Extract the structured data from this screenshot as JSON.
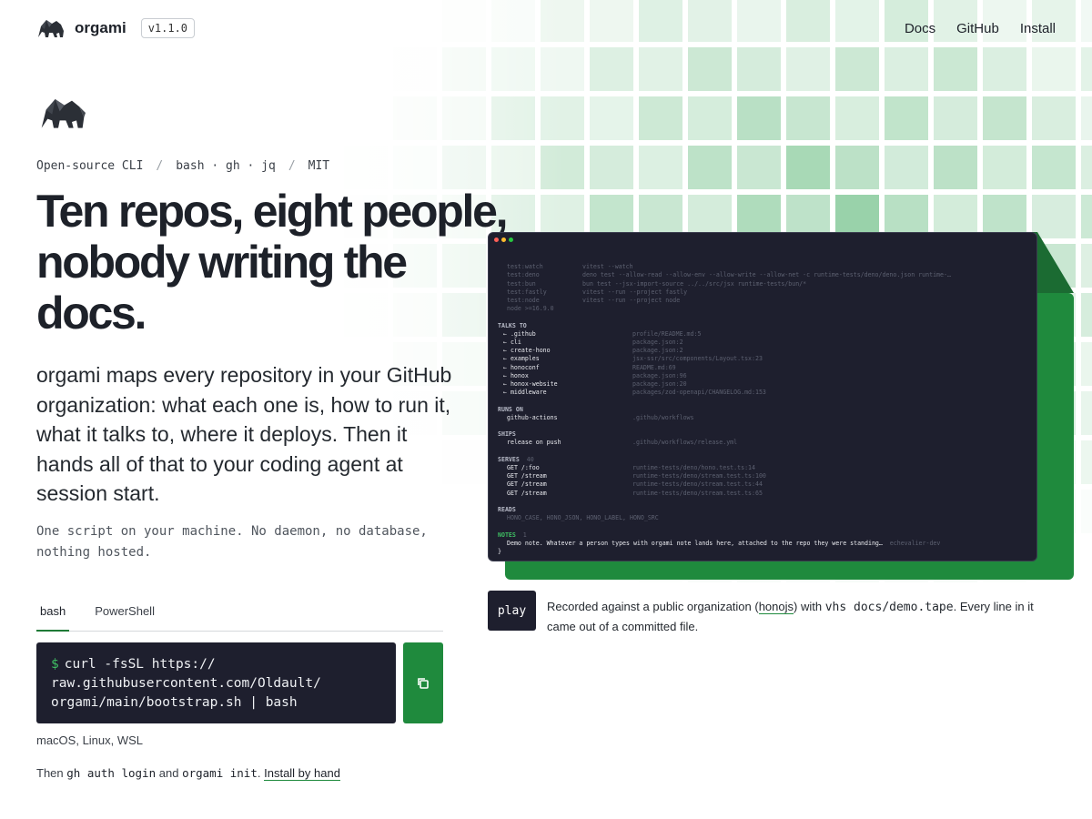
{
  "nav": {
    "brand": "orgami",
    "version": "v1.1.0",
    "links": [
      "Docs",
      "GitHub",
      "Install"
    ]
  },
  "hero": {
    "tagline": [
      "Open-source CLI",
      "bash · gh · jq",
      "MIT"
    ],
    "tagline_separator": "/",
    "headline": "Ten repos, eight people, nobody writing the docs.",
    "lede": "orgami maps every repository in your GitHub organization: what each one is, how to run it, what it talks to, where it deploys. Then it hands all of that to your coding agent at session start.",
    "sub": "One script on your machine. No daemon, no database, nothing hosted."
  },
  "install": {
    "tabs": [
      "bash",
      "PowerShell"
    ],
    "active_tab": "bash",
    "prompt": "$",
    "command_lines": [
      "curl -fsSL https://",
      "raw.githubusercontent.com/Oldault/",
      "orgami/main/bootstrap.sh | bash"
    ],
    "platforms": "macOS, Linux, WSL",
    "then_prefix": "Then",
    "then_cmd1": "gh auth login",
    "then_and": "and",
    "then_cmd2": "orgami init",
    "then_suffix": ".",
    "install_link": "Install by hand"
  },
  "terminal": {
    "scripts": [
      {
        "k": "test:watch",
        "v": "vitest --watch"
      },
      {
        "k": "test:deno",
        "v": "deno test --allow-read --allow-env --allow-write --allow-net -c runtime-tests/deno/deno.json runtime-…"
      },
      {
        "k": "test:bun",
        "v": "bun test --jsx-import-source ../../src/jsx runtime-tests/bun/*"
      },
      {
        "k": "test:fastly",
        "v": "vitest --run --project fastly"
      },
      {
        "k": "test:node",
        "v": "vitest --run --project node"
      }
    ],
    "node_req": "node >=16.9.0",
    "talks_to_label": "TALKS TO",
    "talks_to": [
      {
        "k": "← .github",
        "v": "profile/README.md:5"
      },
      {
        "k": "← cli",
        "v": "package.json:2"
      },
      {
        "k": "← create-hono",
        "v": "package.json:2"
      },
      {
        "k": "← examples",
        "v": "jsx-ssr/src/components/Layout.tsx:23"
      },
      {
        "k": "← honoconf",
        "v": "README.md:69"
      },
      {
        "k": "← honox",
        "v": "package.json:96"
      },
      {
        "k": "← honox-website",
        "v": "package.json:20"
      },
      {
        "k": "← middleware",
        "v": "packages/zod-openapi/CHANGELOG.md:153"
      }
    ],
    "runs_on_label": "RUNS ON",
    "runs_on": [
      {
        "k": "github-actions",
        "v": ".github/workflows"
      }
    ],
    "ships_label": "SHIPS",
    "ships": [
      {
        "k": "release on push",
        "v": ".github/workflows/release.yml"
      }
    ],
    "serves_label": "SERVES",
    "serves_count": "40",
    "serves": [
      {
        "k": "GET /:foo",
        "v": "runtime-tests/deno/hono.test.ts:14"
      },
      {
        "k": "GET /stream",
        "v": "runtime-tests/deno/stream.test.ts:100"
      },
      {
        "k": "GET /stream",
        "v": "runtime-tests/deno/stream.test.ts:44"
      },
      {
        "k": "GET /stream",
        "v": "runtime-tests/deno/stream.test.ts:65"
      }
    ],
    "reads_label": "READS",
    "reads": "HONO_CASE, HONO_JSON, HONO_LABEL, HONO_SRC",
    "notes_label": "NOTES",
    "notes_count": "1",
    "note_text": "Demo note. Whatever a person types with orgami note lands here, attached to the repo they were standing…",
    "note_author": "echevalier-dev",
    "closing": "}"
  },
  "demo": {
    "play": "play",
    "caption_1": "Recorded against a public organization (",
    "caption_link": "honojs",
    "caption_2": ") with",
    "caption_cmd": "vhs docs/demo.tape",
    "caption_3": ". Every line in it came out of a committed file."
  },
  "colors": {
    "accent": "#1f8a3d",
    "terminal_bg": "#1e1f2e",
    "text": "#1d2129"
  },
  "icons": {
    "logo": "elephant-icon",
    "copy": "copy-icon"
  }
}
